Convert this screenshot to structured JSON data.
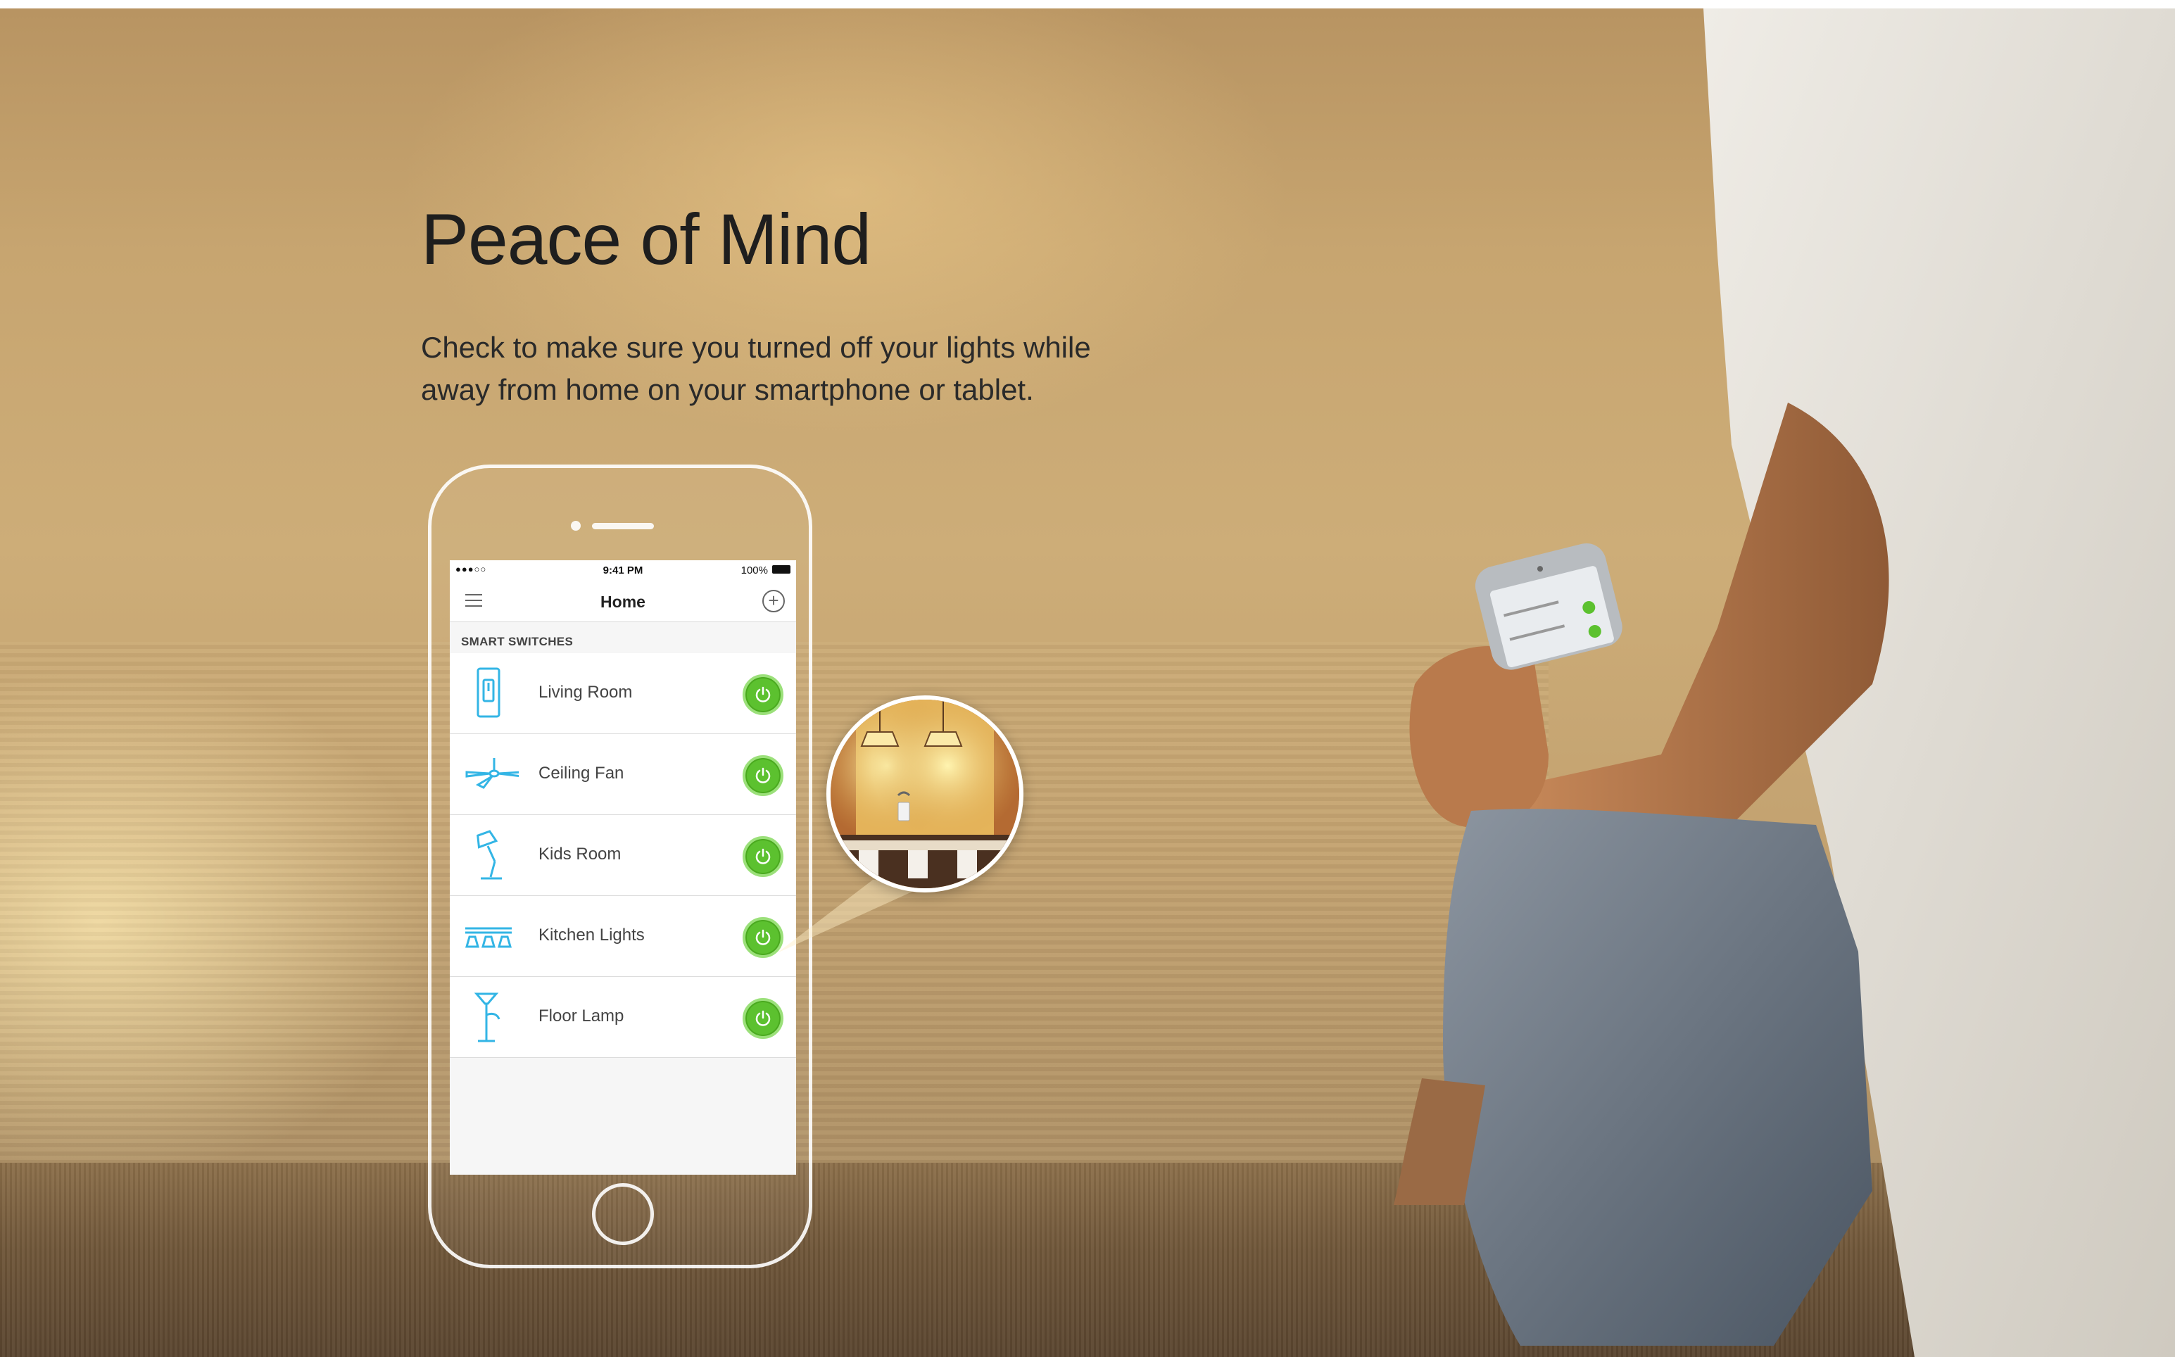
{
  "hero": {
    "title": "Peace of Mind",
    "description": "Check to make sure you turned off your lights while away from home on your smartphone or tablet."
  },
  "app": {
    "status_bar": {
      "signal": "●●●○○",
      "time": "9:41 PM",
      "battery": "100%"
    },
    "nav": {
      "title": "Home"
    },
    "section_label": "SMART SWITCHES",
    "devices": [
      {
        "label": "Living Room",
        "icon": "light-switch-icon",
        "state": "on"
      },
      {
        "label": "Ceiling Fan",
        "icon": "ceiling-fan-icon",
        "state": "on"
      },
      {
        "label": "Kids Room",
        "icon": "desk-lamp-icon",
        "state": "on"
      },
      {
        "label": "Kitchen Lights",
        "icon": "pendant-lights-icon",
        "state": "on"
      },
      {
        "label": "Floor Lamp",
        "icon": "floor-lamp-icon",
        "state": "on"
      }
    ]
  },
  "colors": {
    "accent_green": "#5cc12f",
    "icon_blue": "#33b5e5",
    "title_text": "#1e1e1e"
  }
}
